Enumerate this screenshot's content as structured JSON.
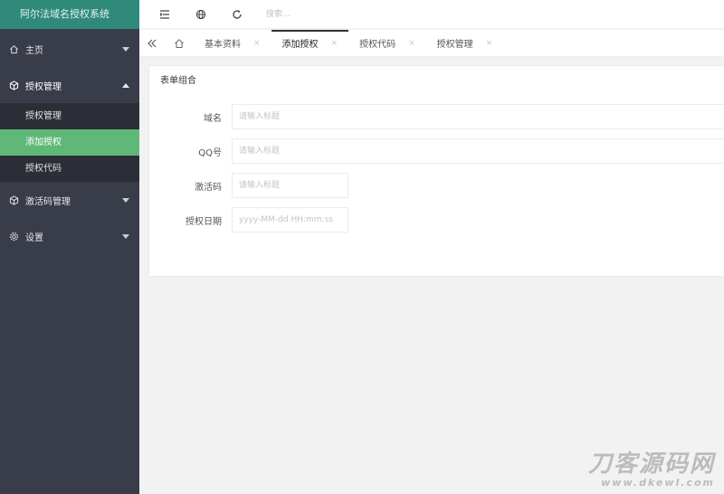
{
  "app": {
    "title": "阿尔法域名授权系统"
  },
  "sidebar": {
    "items": [
      {
        "label": "主页",
        "icon": "home-icon"
      },
      {
        "label": "授权管理",
        "icon": "box-icon",
        "open": true,
        "children": [
          {
            "label": "授权管理"
          },
          {
            "label": "添加授权",
            "active": true
          },
          {
            "label": "授权代码"
          }
        ]
      },
      {
        "label": "激活码管理",
        "icon": "box-icon"
      },
      {
        "label": "设置",
        "icon": "gear-icon"
      }
    ]
  },
  "header": {
    "search_placeholder": "搜索..."
  },
  "tabs": [
    {
      "label": "基本资料",
      "close": "×"
    },
    {
      "label": "添加授权",
      "close": "×",
      "active": true
    },
    {
      "label": "授权代码",
      "close": "×"
    },
    {
      "label": "授权管理",
      "close": "×"
    }
  ],
  "form": {
    "title": "表单组合",
    "fields": [
      {
        "label": "域名",
        "placeholder": "请输入标题"
      },
      {
        "label": "QQ号",
        "placeholder": "请输入标题"
      },
      {
        "label": "激活码",
        "placeholder": "请输入标题"
      },
      {
        "label": "授权日期",
        "placeholder": "yyyy-MM-dd HH:mm:ss"
      }
    ]
  },
  "watermark": {
    "big": "刀客源码网",
    "small": "www.dkewl.com"
  },
  "colors": {
    "sidebar": "#393d49",
    "logo": "#2f8a7a",
    "active": "#5fb878"
  }
}
